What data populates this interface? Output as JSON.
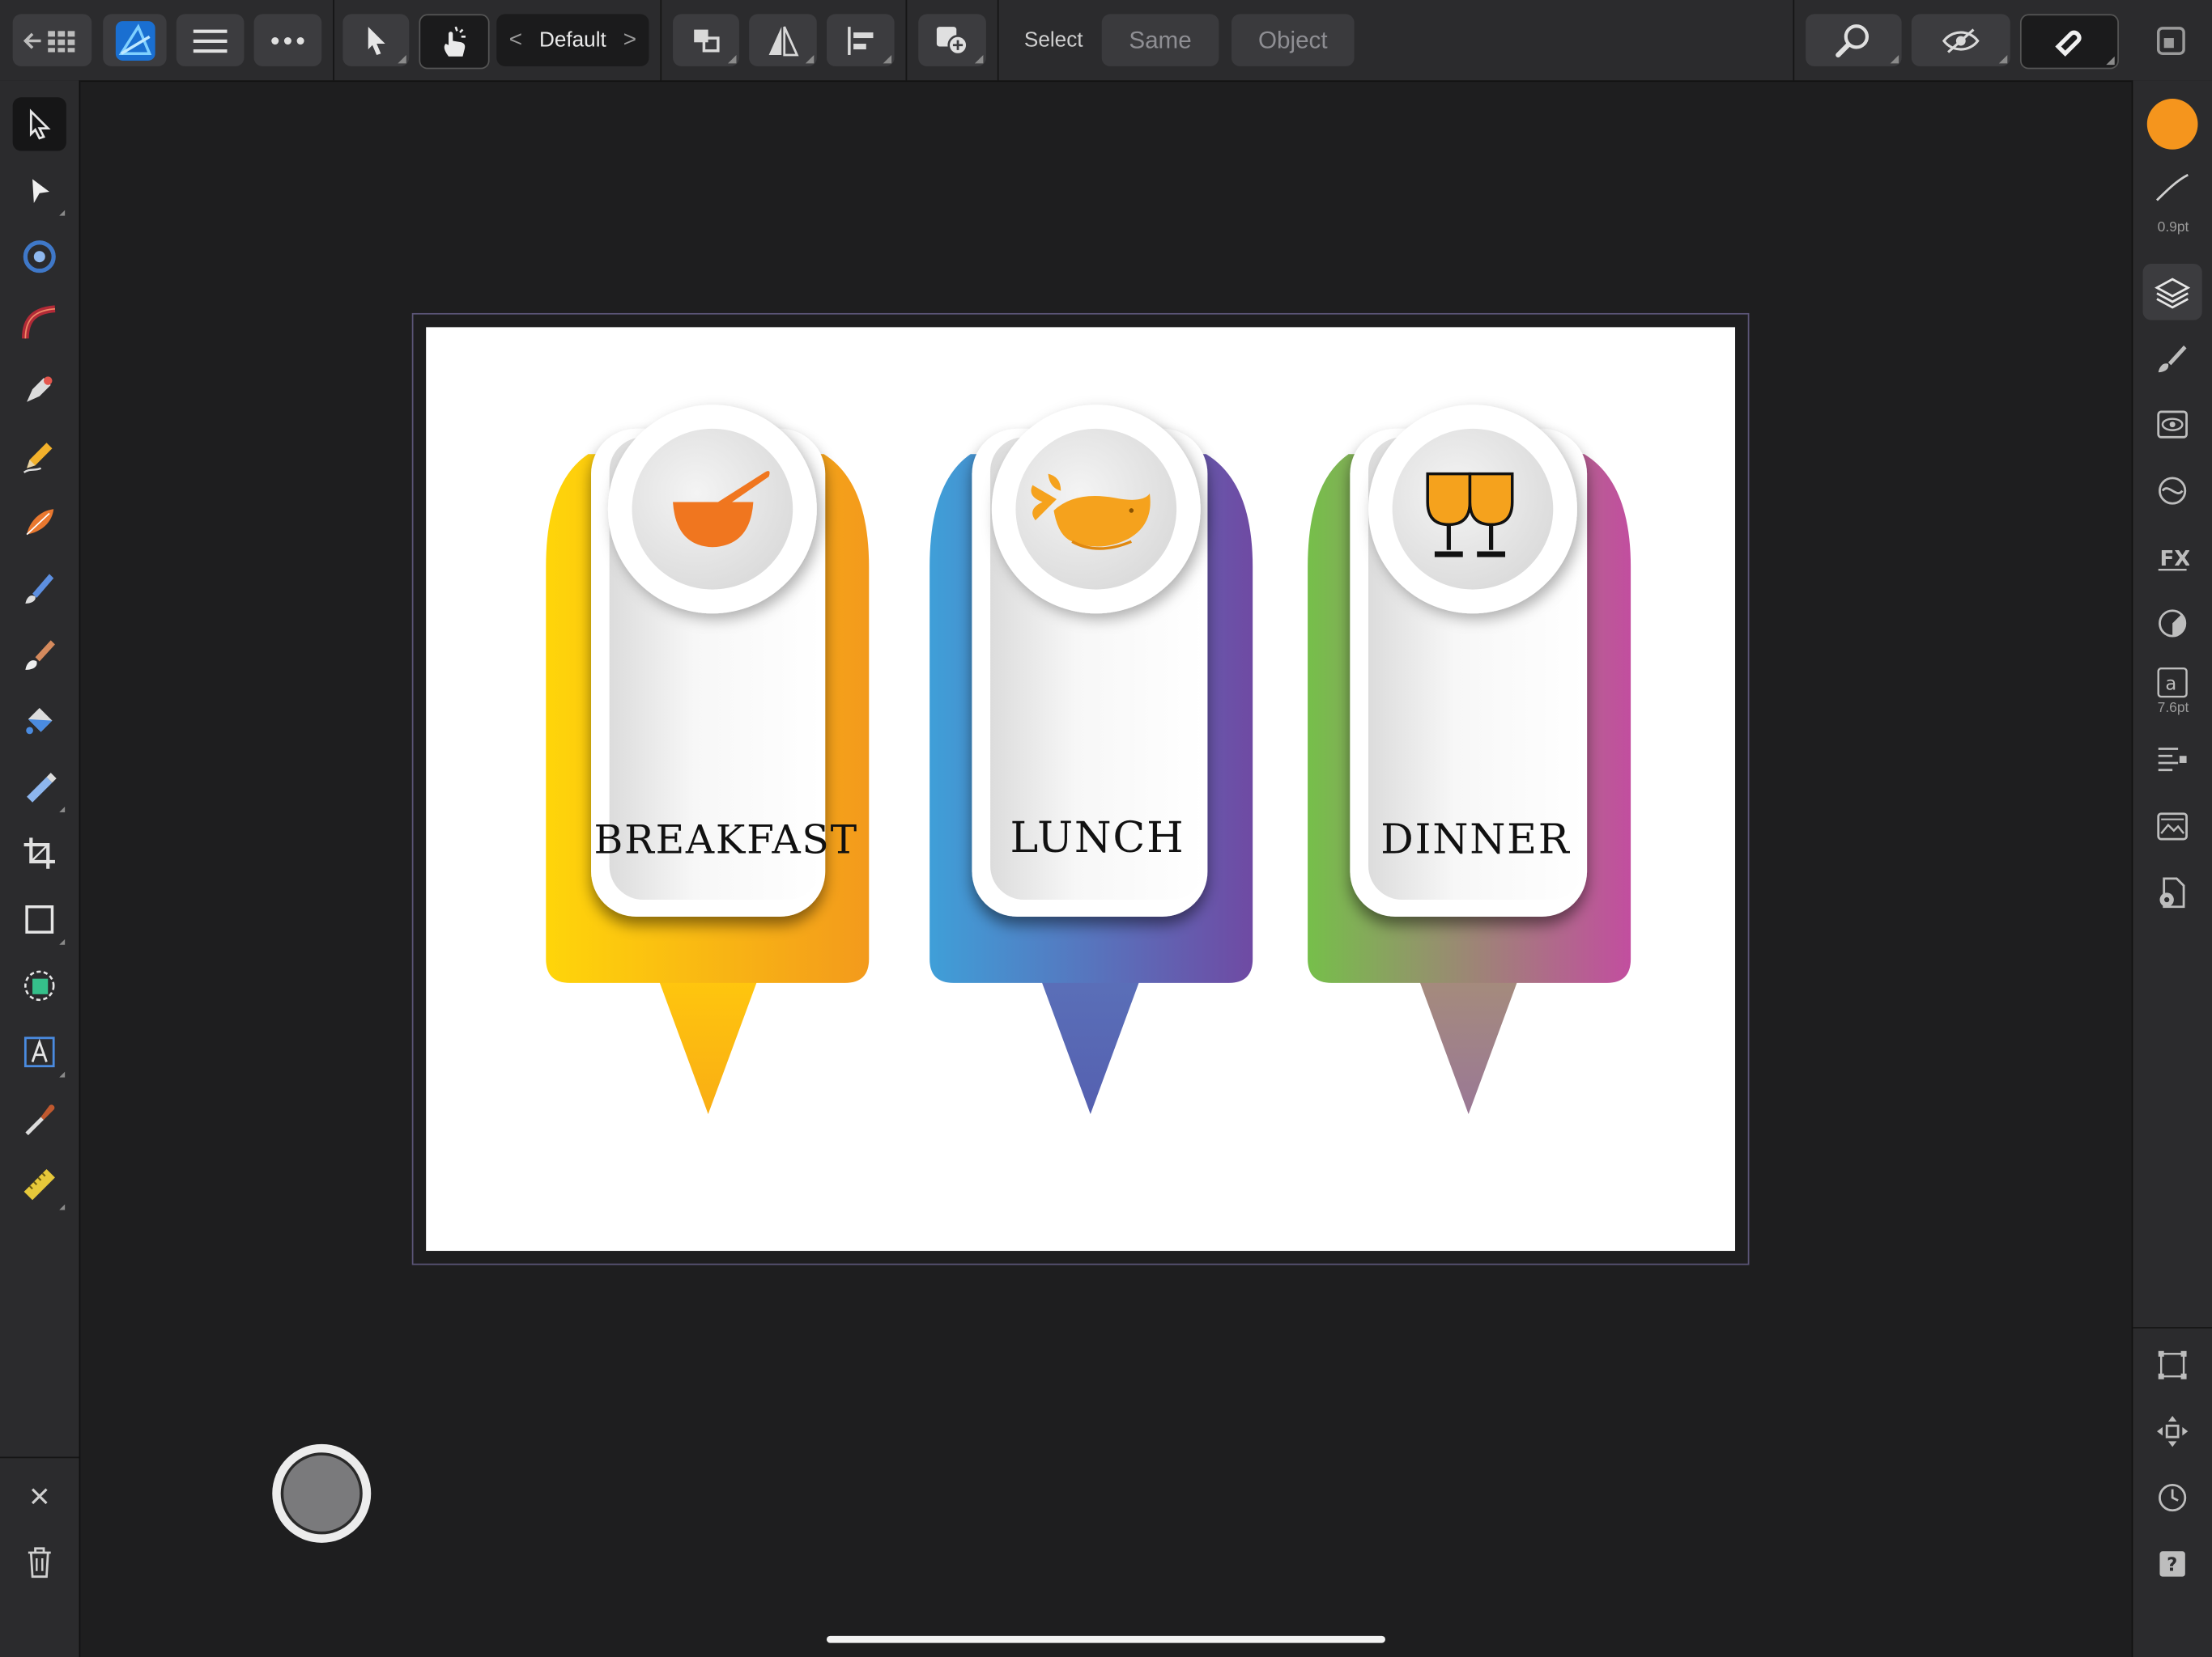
{
  "toolbar": {
    "persona_label": "Default",
    "select_label": "Select",
    "same_label": "Same",
    "object_label": "Object",
    "icons": [
      "back-to-gallery-icon",
      "affinity-designer-logo",
      "menu-icon",
      "more-icon",
      "move-tool-icon",
      "touch-gesture-icon",
      "snapping-icon",
      "arrange-icon",
      "flip-icon",
      "align-icon",
      "insert-icon",
      "view-zoom-icon",
      "hidden-view-icon",
      "snapping-magnet-icon",
      "fullscreen-icon"
    ]
  },
  "tools": [
    "move",
    "node",
    "corner",
    "pen-pencil",
    "pen",
    "pencil",
    "vector-brush",
    "paint-brush",
    "pixel-brush",
    "fill",
    "transparency",
    "crop",
    "rectangle",
    "place-image",
    "artistic-text",
    "color-picker",
    "measure",
    "delete",
    "trash"
  ],
  "studio": {
    "stroke_width": "0.9pt",
    "text_size": "7.6pt",
    "fill_color": "#f5951d"
  },
  "artboard": {
    "cards": [
      {
        "label": "BREAKFAST",
        "icon": "bowl-icon",
        "gradient": [
          "#ffd50a",
          "#f39a1c"
        ]
      },
      {
        "label": "LUNCH",
        "icon": "fish-icon",
        "gradient": [
          "#3f9fd8",
          "#6f4aa3"
        ]
      },
      {
        "label": "DINNER",
        "icon": "wine-glasses-icon",
        "gradient": [
          "#76bf4a",
          "#c24e9f"
        ]
      }
    ]
  }
}
